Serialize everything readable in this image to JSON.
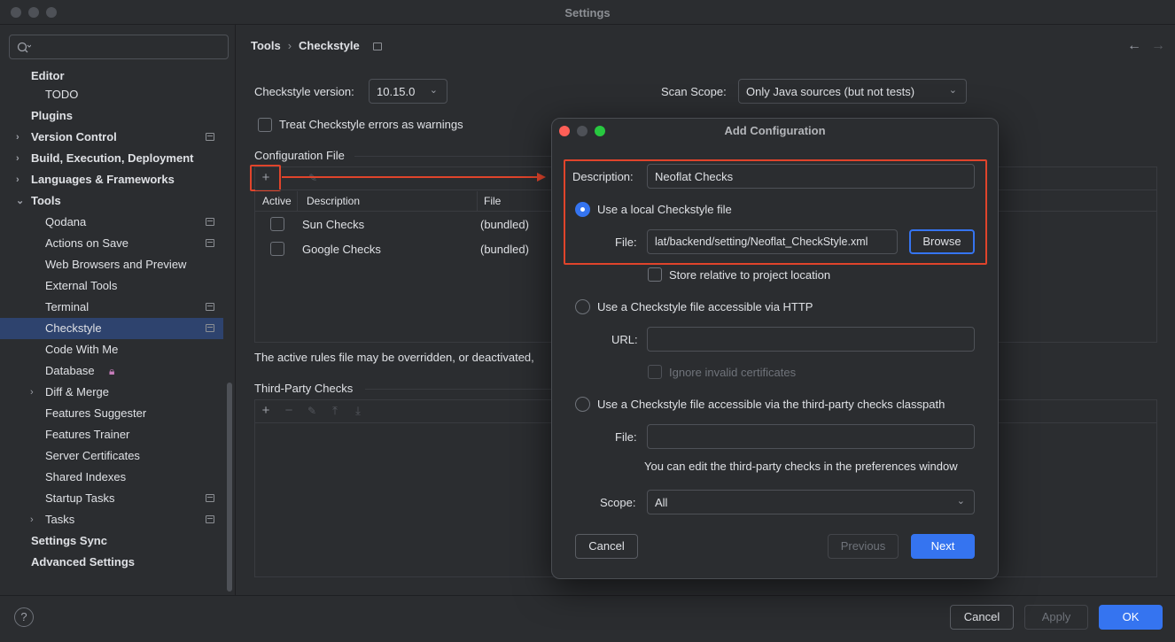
{
  "window": {
    "title": "Settings"
  },
  "sidebar": {
    "items": [
      {
        "label": "Editor",
        "bold": true
      },
      {
        "label": "TODO"
      },
      {
        "label": "Plugins",
        "bold": true
      },
      {
        "label": "Version Control",
        "bold": true
      },
      {
        "label": "Build, Execution, Deployment",
        "bold": true
      },
      {
        "label": "Languages & Frameworks",
        "bold": true
      },
      {
        "label": "Tools",
        "bold": true
      },
      {
        "label": "Qodana"
      },
      {
        "label": "Actions on Save"
      },
      {
        "label": "Web Browsers and Preview"
      },
      {
        "label": "External Tools"
      },
      {
        "label": "Terminal"
      },
      {
        "label": "Checkstyle"
      },
      {
        "label": "Code With Me"
      },
      {
        "label": "Database"
      },
      {
        "label": "Diff & Merge"
      },
      {
        "label": "Features Suggester"
      },
      {
        "label": "Features Trainer"
      },
      {
        "label": "Server Certificates"
      },
      {
        "label": "Shared Indexes"
      },
      {
        "label": "Startup Tasks"
      },
      {
        "label": "Tasks"
      },
      {
        "label": "Settings Sync",
        "bold": true
      },
      {
        "label": "Advanced Settings",
        "bold": true
      }
    ]
  },
  "breadcrumb": {
    "parent": "Tools",
    "current": "Checkstyle"
  },
  "main": {
    "version_label": "Checkstyle version:",
    "version_value": "10.15.0",
    "scope_label": "Scan Scope:",
    "scope_value": "Only Java sources (but not tests)",
    "treat_errors_label": "Treat Checkstyle errors as warnings",
    "config_section": "Configuration File",
    "table_headers": {
      "active": "Active",
      "description": "Description",
      "file": "File"
    },
    "rows": [
      {
        "description": "Sun Checks",
        "file": "(bundled)"
      },
      {
        "description": "Google Checks",
        "file": "(bundled)"
      }
    ],
    "note": "The active rules file may be overridden, or deactivated,",
    "third_party_section": "Third-Party Checks"
  },
  "dialog": {
    "title": "Add Configuration",
    "description_label": "Description:",
    "description_value": "Neoflat Checks",
    "local_option": "Use a local Checkstyle file",
    "file_label": "File:",
    "file_value": "lat/backend/setting/Neoflat_CheckStyle.xml",
    "browse": "Browse",
    "store_relative": "Store relative to project location",
    "http_option": "Use a Checkstyle file accessible via HTTP",
    "url_label": "URL:",
    "url_value": "",
    "ignore_certs": "Ignore invalid certificates",
    "classpath_option": "Use a Checkstyle file accessible via the third-party checks classpath",
    "file2_label": "File:",
    "file2_value": "",
    "classpath_note": "You can edit the third-party checks in the preferences window",
    "scope_label": "Scope:",
    "scope_value": "All",
    "cancel": "Cancel",
    "previous": "Previous",
    "next": "Next"
  },
  "footer": {
    "help": "?",
    "cancel": "Cancel",
    "apply": "Apply",
    "ok": "OK"
  },
  "colors": {
    "accent": "#3574f0",
    "highlight": "#e0442b",
    "selection": "#2e436e"
  }
}
